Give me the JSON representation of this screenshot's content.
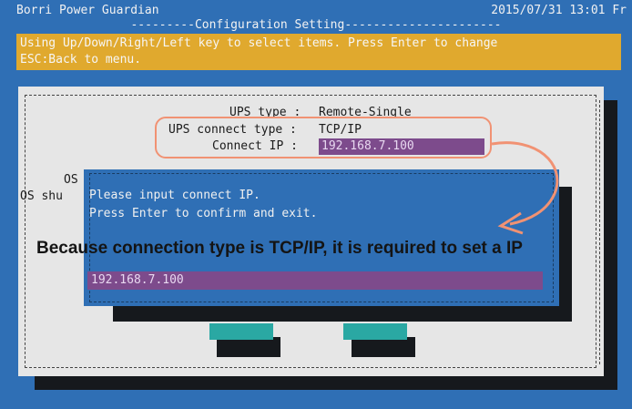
{
  "header": {
    "app_title": "Borri Power Guardian",
    "datetime": "2015/07/31 13:01 Fr",
    "config_title": "Configuration Setting"
  },
  "hint": {
    "line1": "Using Up/Down/Right/Left key to select items. Press Enter to change",
    "line2": "ESC:Back to menu."
  },
  "form": {
    "ups_type_label": "UPS type :",
    "ups_type_value": "Remote-Single",
    "connect_type_label": "UPS connect type :",
    "connect_type_value": "TCP/IP",
    "connect_ip_label": "Connect IP :",
    "connect_ip_value": "192.168.7.100",
    "os_label_1": "OS",
    "os_label_2": "OS shu"
  },
  "dialog": {
    "message_line1": "Please input connect IP.",
    "message_line2": "Press Enter to confirm and exit.",
    "input_value": "192.168.7.100"
  },
  "annotation": {
    "text": "Because connection type is TCP/IP, it is required to set a IP"
  },
  "colors": {
    "background": "#2f6fb5",
    "hint_bar": "#e0a92e",
    "panel": "#e6e6e6",
    "input_highlight": "#7d4b8c",
    "button": "#2aa8a3",
    "annotation_outline": "#f19273"
  }
}
